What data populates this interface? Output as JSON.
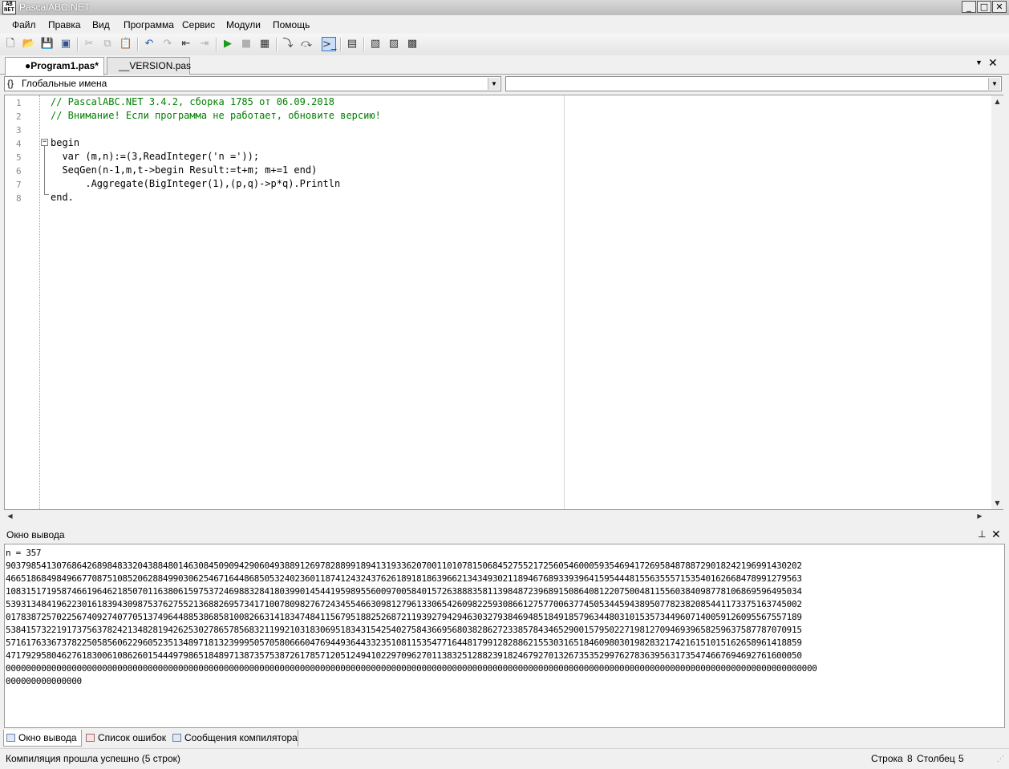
{
  "window": {
    "title": "PascalABC.NET",
    "icon_text": "AB\nNET"
  },
  "menu": [
    "Файл",
    "Правка",
    "Вид",
    "Программа",
    "Сервис",
    "Модули",
    "Помощь"
  ],
  "tabs": [
    {
      "label": "●Program1.pas*",
      "active": true
    },
    {
      "label": "__VERSION.pas",
      "active": false
    }
  ],
  "scope_combo": {
    "value": "Глобальные имена",
    "prefix": "{}"
  },
  "member_combo": {
    "value": ""
  },
  "editor": {
    "line_numbers": [
      "1",
      "2",
      "3",
      "4",
      "5",
      "6",
      "7",
      "8"
    ],
    "lines": [
      "// PascalABC.NET 3.4.2, сборка 1785 от 06.09.2018",
      "// Внимание! Если программа не работает, обновите версию!",
      "",
      "begin",
      "  var (m,n):=(3,ReadInteger('n ='));",
      "  SeqGen(n-1,m,t->begin Result:=t+m; m+=1 end)",
      "      .Aggregate(BigInteger(1),(p,q)->p*q).Println",
      "end."
    ]
  },
  "output_panel": {
    "title": "Окно вывода",
    "pin_icon": "pin-icon",
    "lines": [
      "n = 357",
      "9037985413076864268984833204388480146308450909429060493889126978288991894131933620700110107815068452755217256054600059354694172695848788729018242196991430202",
      "4665186849849667708751085206288499030625467164486850532402360118741243243762618918186396621343493021189467689339396415954448155635557153540162668478991279563",
      "1083151719587466196462185070116380615975372469883284180399014544195989556009700584015726388835811398487239689150864081220750048115560384098778106869596495034",
      "5393134841962230161839430987537627552136882695734171007809827672434554663098127961330654260982259308661275770063774505344594389507782382085441173375163745002",
      "0178387257022567409274077051374964488538685810082663141834748411567951882526872119392794294630327938469485184918579634480310153573449607140059126095567557189",
      "5384157322191737563782421348281942625302786578568321199210318306951834315425402758436695680382862723385784346529001579502271981270946939658259637587787070915",
      "5716176336737822505856062296052351348971813239995057058066604769449364433235108115354771644817991282886215530316518460980301982832174216151015162658961418859",
      "4717929580462761830061086260154449798651848971387357538726178571205124941022970962701138325128823918246792701326735352997627836395631735474667694692761600050",
      "0000000000000000000000000000000000000000000000000000000000000000000000000000000000000000000000000000000000000000000000000000000000000000000000000000000000000000",
      "000000000000000"
    ]
  },
  "bottom_tabs": [
    "Окно вывода",
    "Список ошибок",
    "Сообщения компилятора"
  ],
  "status": {
    "message": "Компиляция прошла успешно (5 строк)",
    "row_label": "Строка",
    "row_value": "8",
    "col_label": "Столбец",
    "col_value": "5"
  }
}
